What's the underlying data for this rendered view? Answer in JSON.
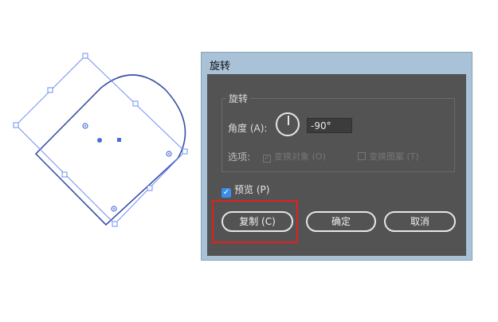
{
  "dialog": {
    "title": "旋转",
    "group_title": "旋转",
    "angle_label": "角度 (A):",
    "angle_value": "-90°",
    "options_label": "选项:",
    "transform_objects": "变换对象 (O)",
    "transform_patterns": "变换图案 (T)",
    "preview_label": "预览 (P)",
    "copy_label": "复制 (C)",
    "ok_label": "确定",
    "cancel_label": "取消",
    "preview_checked": true,
    "transform_objects_checked": true,
    "transform_patterns_checked": false
  },
  "icons": {
    "angle_dial": "angle-dial-icon",
    "check": "check-icon"
  },
  "colors": {
    "dialog_titlebar": "#a9c2d8",
    "dialog_body": "#535353",
    "selection_blue": "#4a6fd6",
    "highlight_red": "#e02020",
    "checkbox_blue": "#3b8ee8"
  }
}
